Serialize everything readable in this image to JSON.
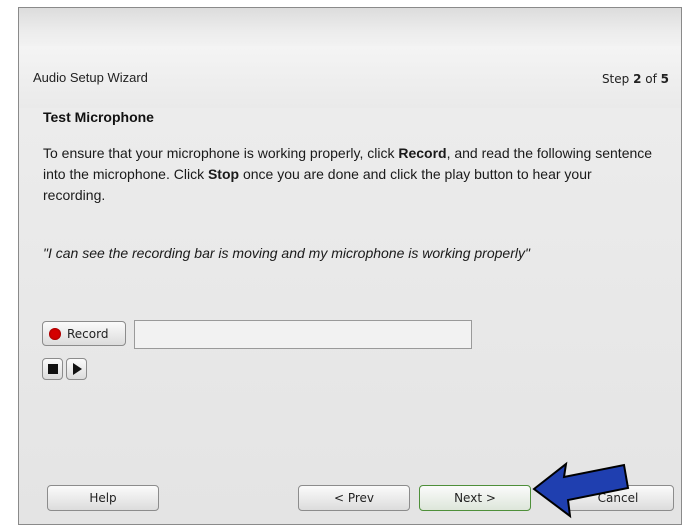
{
  "wizard": {
    "title": "Audio Setup Wizard",
    "step_prefix": "Step ",
    "step_current": "2",
    "step_mid": " of ",
    "step_total": "5"
  },
  "content": {
    "section_title": "Test Microphone",
    "instr_1": "To ensure that your microphone is working properly, click ",
    "instr_record": "Record",
    "instr_2": ", and read the following sentence into the microphone. Click ",
    "instr_stop": "Stop",
    "instr_3": " once you are done and click the play button to hear your recording.",
    "quote": "\"I can see the recording bar is moving and my microphone is working properly\""
  },
  "controls": {
    "record_label": "Record",
    "record_dot_color": "#d40000",
    "stop_icon": "stop-icon",
    "play_icon": "play-icon",
    "level_value": 0
  },
  "footer": {
    "help_label": "Help",
    "prev_label": "< Prev",
    "next_label": "Next >",
    "cancel_label": "Cancel"
  },
  "annotation": {
    "arrow_color": "#1f3fb0",
    "arrow_icon": "pointer-arrow"
  }
}
